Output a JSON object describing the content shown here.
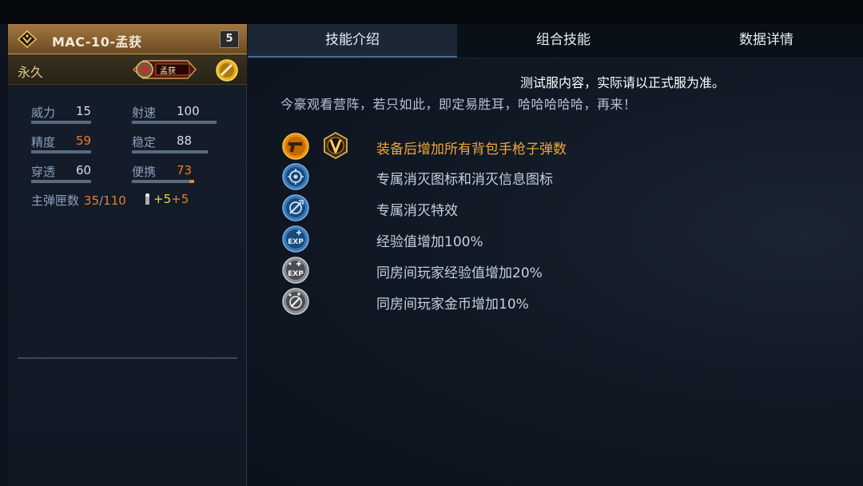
{
  "weapon": {
    "name": "MAC-10-孟获",
    "level": "5",
    "duration": "永久",
    "title_badge": "孟获"
  },
  "stats": [
    {
      "label": "威力",
      "value": "15",
      "value_color": "normal",
      "fill": 0.45
    },
    {
      "label": "射速",
      "value": "100",
      "value_color": "normal",
      "fill": 1.0
    },
    {
      "label": "精度",
      "value": "59",
      "value_color": "orange",
      "fill": 0.8
    },
    {
      "label": "稳定",
      "value": "88",
      "value_color": "normal",
      "fill": 0.95
    },
    {
      "label": "穿透",
      "value": "60",
      "value_color": "normal",
      "fill": 0.85
    },
    {
      "label": "便携",
      "value": "73",
      "value_color": "orange",
      "fill": 0.9
    }
  ],
  "ammo": {
    "label": "主弹匣数",
    "current": "35",
    "separator": "/",
    "max": "110",
    "bonus1": "+5",
    "bonus2": "+5"
  },
  "tabs": [
    {
      "label": "技能介绍",
      "active": true
    },
    {
      "label": "组合技能",
      "active": false
    },
    {
      "label": "数据详情",
      "active": false
    }
  ],
  "notice": "测试服内容，实际请以正式服为准。",
  "quote": "今豪观看营阵，若只如此，即定易胜耳，哈哈哈哈哈，再来！",
  "skills": [
    {
      "icon": "pistol-ammo-icon",
      "text": "装备后增加所有背包手枪子弹数",
      "highlight": true
    },
    {
      "icon": "kill-icon-emblem",
      "text": "专属消灭图标和消灭信息图标",
      "highlight": false
    },
    {
      "icon": "kill-effect-icon",
      "text": "专属消灭特效",
      "highlight": false
    },
    {
      "icon": "exp-boost-icon",
      "text": "经验值增加100%",
      "highlight": false
    },
    {
      "icon": "room-exp-boost-icon",
      "text": "同房间玩家经验值增加20%",
      "highlight": false
    },
    {
      "icon": "room-coin-boost-icon",
      "text": "同房间玩家金币增加10%",
      "highlight": false
    }
  ],
  "colors": {
    "accent_orange": "#f07a2a",
    "gold_text": "#f0a53a",
    "header_gold": "#a3783f"
  }
}
